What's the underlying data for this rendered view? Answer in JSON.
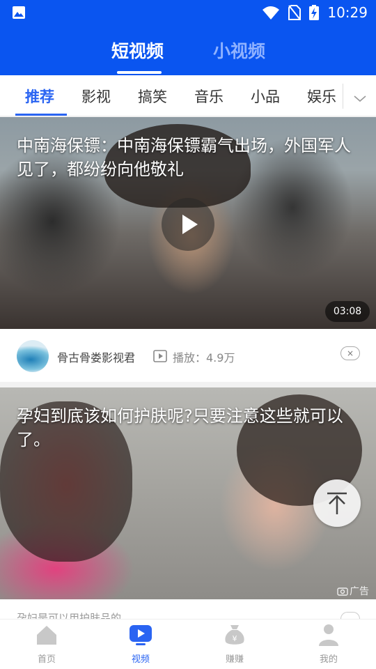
{
  "status_bar": {
    "time": "10:29",
    "icons": [
      "image-icon",
      "wifi-icon",
      "no-sim-icon",
      "battery-charging-icon"
    ]
  },
  "header": {
    "tabs": [
      {
        "label": "短视频",
        "active": true
      },
      {
        "label": "小视频",
        "active": false
      }
    ]
  },
  "categories": {
    "items": [
      {
        "label": "推荐",
        "active": true
      },
      {
        "label": "影视"
      },
      {
        "label": "搞笑"
      },
      {
        "label": "音乐"
      },
      {
        "label": "小品"
      },
      {
        "label": "娱乐"
      }
    ],
    "more_icon": "chevron-down-icon"
  },
  "feed": [
    {
      "title": "中南海保镖：中南海保镖霸气出场，外国军人见了，都纷纷向他敬礼",
      "duration": "03:08",
      "author": "骨古骨娄影视君",
      "plays": "播放：4.9万",
      "close": "×"
    },
    {
      "title": "孕妇到底该如何护肤呢?只要注意这些就可以了。",
      "ad_label": "广告",
      "next_text": "孕妇是可以用护肤品的"
    }
  ],
  "bottom_nav": {
    "items": [
      {
        "label": "首页",
        "icon": "home-icon",
        "active": false
      },
      {
        "label": "视频",
        "icon": "video-icon",
        "active": true
      },
      {
        "label": "赚赚",
        "icon": "money-bag-icon",
        "active": false
      },
      {
        "label": "我的",
        "icon": "profile-icon",
        "active": false
      }
    ]
  },
  "colors": {
    "brand_blue": "#0a55f0",
    "active_blue": "#2a64f2",
    "inactive_gray": "#999999"
  }
}
